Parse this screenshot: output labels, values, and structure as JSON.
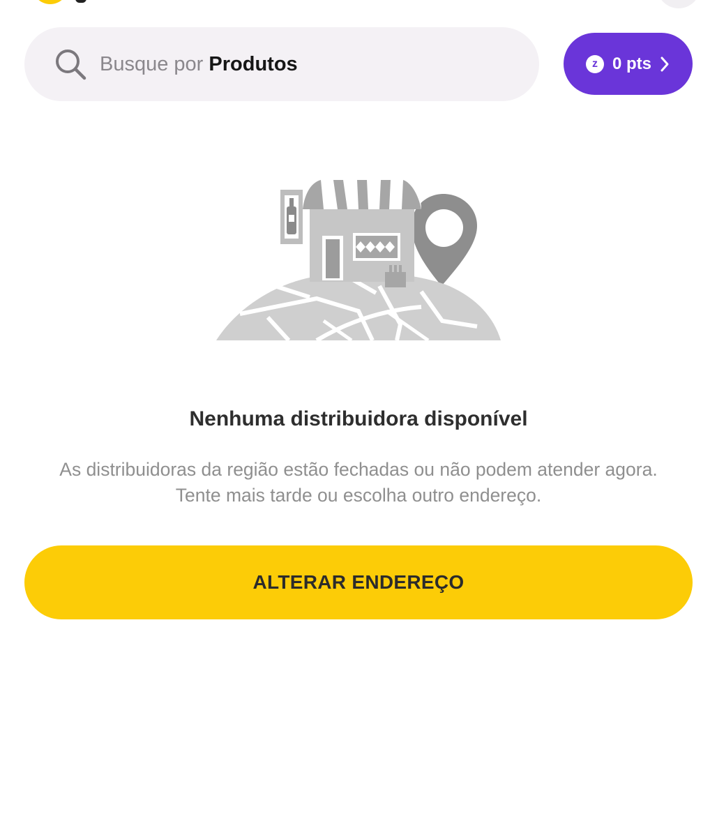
{
  "header": {
    "logo_icon": "ze-logo-icon",
    "right_icon": "profile-button-icon"
  },
  "search": {
    "icon": "search-icon",
    "prefix": "Busque por",
    "highlight": "Produtos"
  },
  "points": {
    "icon": "ze-coin-icon",
    "coin_symbol": "z",
    "label": "0 pts",
    "chevron_icon": "chevron-right-icon",
    "bg_color": "#6a35d9"
  },
  "empty_state": {
    "illustration": "closed-store-map-illustration",
    "title": "Nenhuma distribuidora disponível",
    "line1": "As distribuidoras da região estão fechadas ou não podem atender agora.",
    "line2": "Tente mais tarde ou escolha outro endereço."
  },
  "cta": {
    "label": "ALTERAR ENDEREÇO",
    "bg_color": "#fccc07"
  }
}
